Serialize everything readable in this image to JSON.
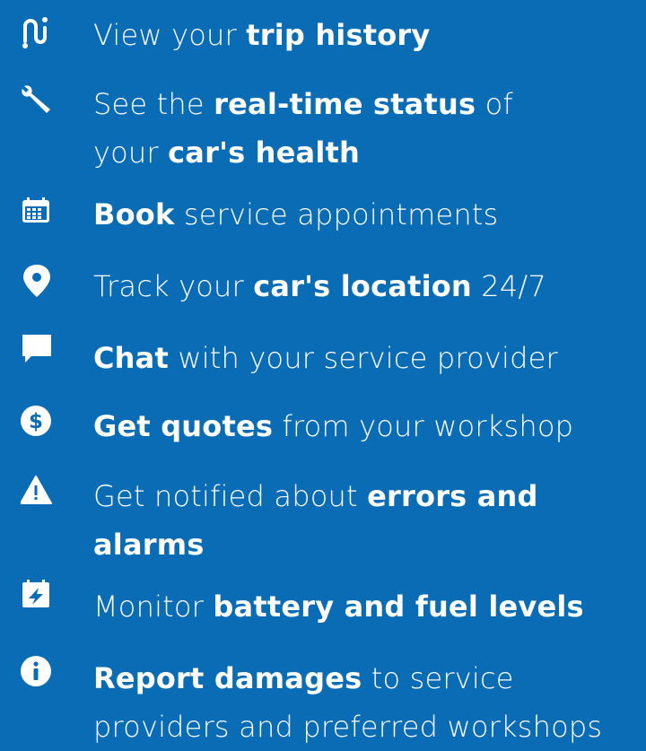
{
  "features": [
    {
      "icon": "route-icon",
      "parts": [
        {
          "t": "View your ",
          "b": false
        },
        {
          "t": "trip history",
          "b": true
        }
      ]
    },
    {
      "icon": "wrench-icon",
      "parts": [
        {
          "t": "See the ",
          "b": false
        },
        {
          "t": "real-time status",
          "b": true
        },
        {
          "t": " of",
          "b": false
        },
        {
          "t": "\n",
          "b": false
        },
        {
          "t": "your ",
          "b": false
        },
        {
          "t": "car's health",
          "b": true
        }
      ]
    },
    {
      "icon": "calendar-icon",
      "parts": [
        {
          "t": "Book",
          "b": true
        },
        {
          "t": " service appointments",
          "b": false
        }
      ]
    },
    {
      "icon": "location-pin-icon",
      "parts": [
        {
          "t": "Track your ",
          "b": false
        },
        {
          "t": "car's location",
          "b": true
        },
        {
          "t": " 24/7",
          "b": false
        }
      ]
    },
    {
      "icon": "chat-icon",
      "parts": [
        {
          "t": "Chat",
          "b": true
        },
        {
          "t": " with your service provider",
          "b": false
        }
      ]
    },
    {
      "icon": "dollar-icon",
      "parts": [
        {
          "t": "Get quotes",
          "b": true
        },
        {
          "t": " from your workshop",
          "b": false
        }
      ]
    },
    {
      "icon": "warning-icon",
      "parts": [
        {
          "t": "Get notified about ",
          "b": false
        },
        {
          "t": "errors and",
          "b": true
        },
        {
          "t": "\n",
          "b": false
        },
        {
          "t": "alarms",
          "b": true
        }
      ]
    },
    {
      "icon": "battery-calendar-icon",
      "parts": [
        {
          "t": "Monitor ",
          "b": false
        },
        {
          "t": "battery and fuel levels",
          "b": true
        }
      ]
    },
    {
      "icon": "info-icon",
      "parts": [
        {
          "t": "Report damages",
          "b": true
        },
        {
          "t": " to service",
          "b": false
        },
        {
          "t": "\n",
          "b": false
        },
        {
          "t": "providers and preferred workshops",
          "b": false
        }
      ]
    }
  ]
}
